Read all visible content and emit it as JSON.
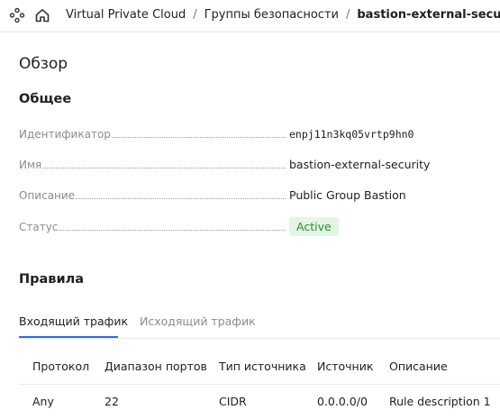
{
  "header": {
    "breadcrumb": [
      "Virtual Private Cloud",
      "Группы безопасности",
      "bastion-external-security"
    ],
    "separator": "/"
  },
  "icons": {
    "app_menu": "apps-grid-icon",
    "home": "home-icon"
  },
  "overview": {
    "title": "Обзор",
    "general_title": "Общее",
    "fields": [
      {
        "label": "Идентификатор",
        "value": "enpj11n3kq05vrtp9hn0"
      },
      {
        "label": "Имя",
        "value": "bastion-external-security"
      },
      {
        "label": "Описание",
        "value": "Public Group Bastion"
      },
      {
        "label": "Статус",
        "value": "Active"
      }
    ]
  },
  "colors": {
    "status_bg": "#e3f5e3",
    "status_text": "#2d8b3b",
    "accent": "#2a6cf0"
  },
  "rules": {
    "title": "Правила",
    "tabs": [
      {
        "label": "Входящий трафик",
        "active": true
      },
      {
        "label": "Исходящий трафик",
        "active": false
      }
    ],
    "columns": [
      "Протокол",
      "Диапазон портов",
      "Тип источника",
      "Источник",
      "Описание"
    ],
    "rows": [
      [
        "Any",
        "22",
        "CIDR",
        "0.0.0.0/0",
        "Rule description 1"
      ]
    ]
  }
}
